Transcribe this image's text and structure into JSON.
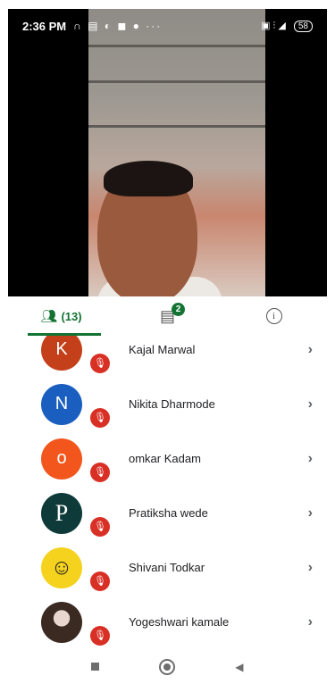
{
  "status_bar": {
    "time": "2:36 PM",
    "notification_glyphs": "∩ ▤ ◐ ◼ ● ···",
    "right_glyphs": "▣ ⫶ ◢",
    "battery": "58"
  },
  "tabs": {
    "people_count": "(13)",
    "chat_badge": "2",
    "info_glyph": "i"
  },
  "participants": [
    {
      "initial": "K",
      "name": "Kajal Marwal",
      "avatar_color": "#c4401b"
    },
    {
      "initial": "N",
      "name": "Nikita Dharmode",
      "avatar_color": "#1a5fbf"
    },
    {
      "initial": "o",
      "name": "omkar Kadam",
      "avatar_color": "#f2561d"
    },
    {
      "initial": "P",
      "name": "Pratiksha wede",
      "avatar_color": "#0f3a3a"
    },
    {
      "initial": "",
      "name": "Shivani Todkar",
      "avatar_color": "#f4d21e"
    },
    {
      "initial": "",
      "name": "Yogeshwari kamale",
      "avatar_color": "#3a2a22"
    }
  ],
  "colors": {
    "accent": "#137333",
    "muted_mic": "#d93025"
  }
}
